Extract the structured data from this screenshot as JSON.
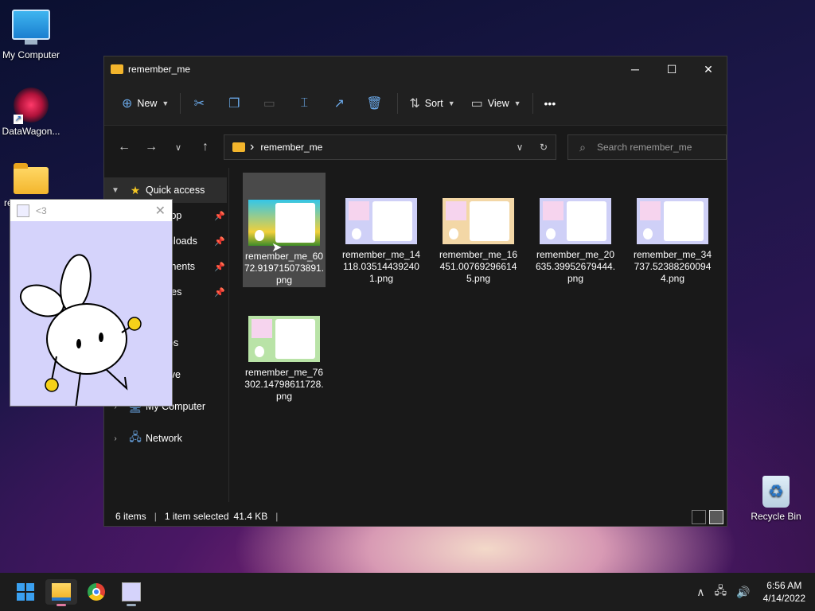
{
  "desktop": {
    "icons": [
      {
        "label": "My Computer",
        "icon": "monitor-icon"
      },
      {
        "label": "DataWagon...",
        "icon": "datawagon-icon"
      },
      {
        "label": "re",
        "icon": "folder-icon"
      },
      {
        "label": "Recycle Bin",
        "icon": "recycle-bin-icon"
      }
    ]
  },
  "explorer": {
    "title": "remember_me",
    "window_controls": {
      "minimize": "─",
      "maximize": "☐",
      "close": "✕"
    },
    "toolbar": {
      "new_label": "New",
      "sort_label": "Sort",
      "view_label": "View",
      "more_label": "•••"
    },
    "address": {
      "crumb": "remember_me",
      "search_placeholder": "Search remember_me"
    },
    "sidebar": {
      "items": [
        {
          "label": "Quick access",
          "icon": "star-icon"
        },
        {
          "label": "top",
          "icon": "desktop-icon"
        },
        {
          "label": "nloads",
          "icon": "downloads-icon"
        },
        {
          "label": "ments",
          "icon": "documents-icon"
        },
        {
          "label": "res",
          "icon": "pictures-icon"
        },
        {
          "label": "c",
          "icon": "music-icon"
        },
        {
          "label": "os",
          "icon": "videos-icon"
        },
        {
          "label": "ive",
          "icon": "onedrive-icon"
        },
        {
          "label": "My Computer",
          "icon": "computer-icon"
        },
        {
          "label": "Network",
          "icon": "network-icon"
        }
      ]
    },
    "files": [
      {
        "name": "remember_me_6072.919715073891.png",
        "selected": true
      },
      {
        "name": "remember_me_14118.035144392401.png",
        "selected": false
      },
      {
        "name": "remember_me_16451.007692966145.png",
        "selected": false
      },
      {
        "name": "remember_me_20635.39952679444.png",
        "selected": false
      },
      {
        "name": "remember_me_34737.523882600944.png",
        "selected": false
      },
      {
        "name": "remember_me_76302.14798611728.png",
        "selected": false
      }
    ],
    "status": {
      "items": "6 items",
      "selected": "1 item selected",
      "size": "41.4 KB",
      "separator": "|"
    }
  },
  "popup": {
    "title": "<3",
    "close": "✕"
  },
  "taskbar": {
    "apps": [
      "start-button",
      "file-explorer",
      "chrome",
      "bunny-app"
    ],
    "tray": {
      "time": "6:56 AM",
      "date": "4/14/2022"
    }
  },
  "colors": {
    "accent": "#6aa8e8",
    "folder": "#f3b52c",
    "window_bg": "#191919",
    "popup_bg": "#d5d3fb"
  }
}
